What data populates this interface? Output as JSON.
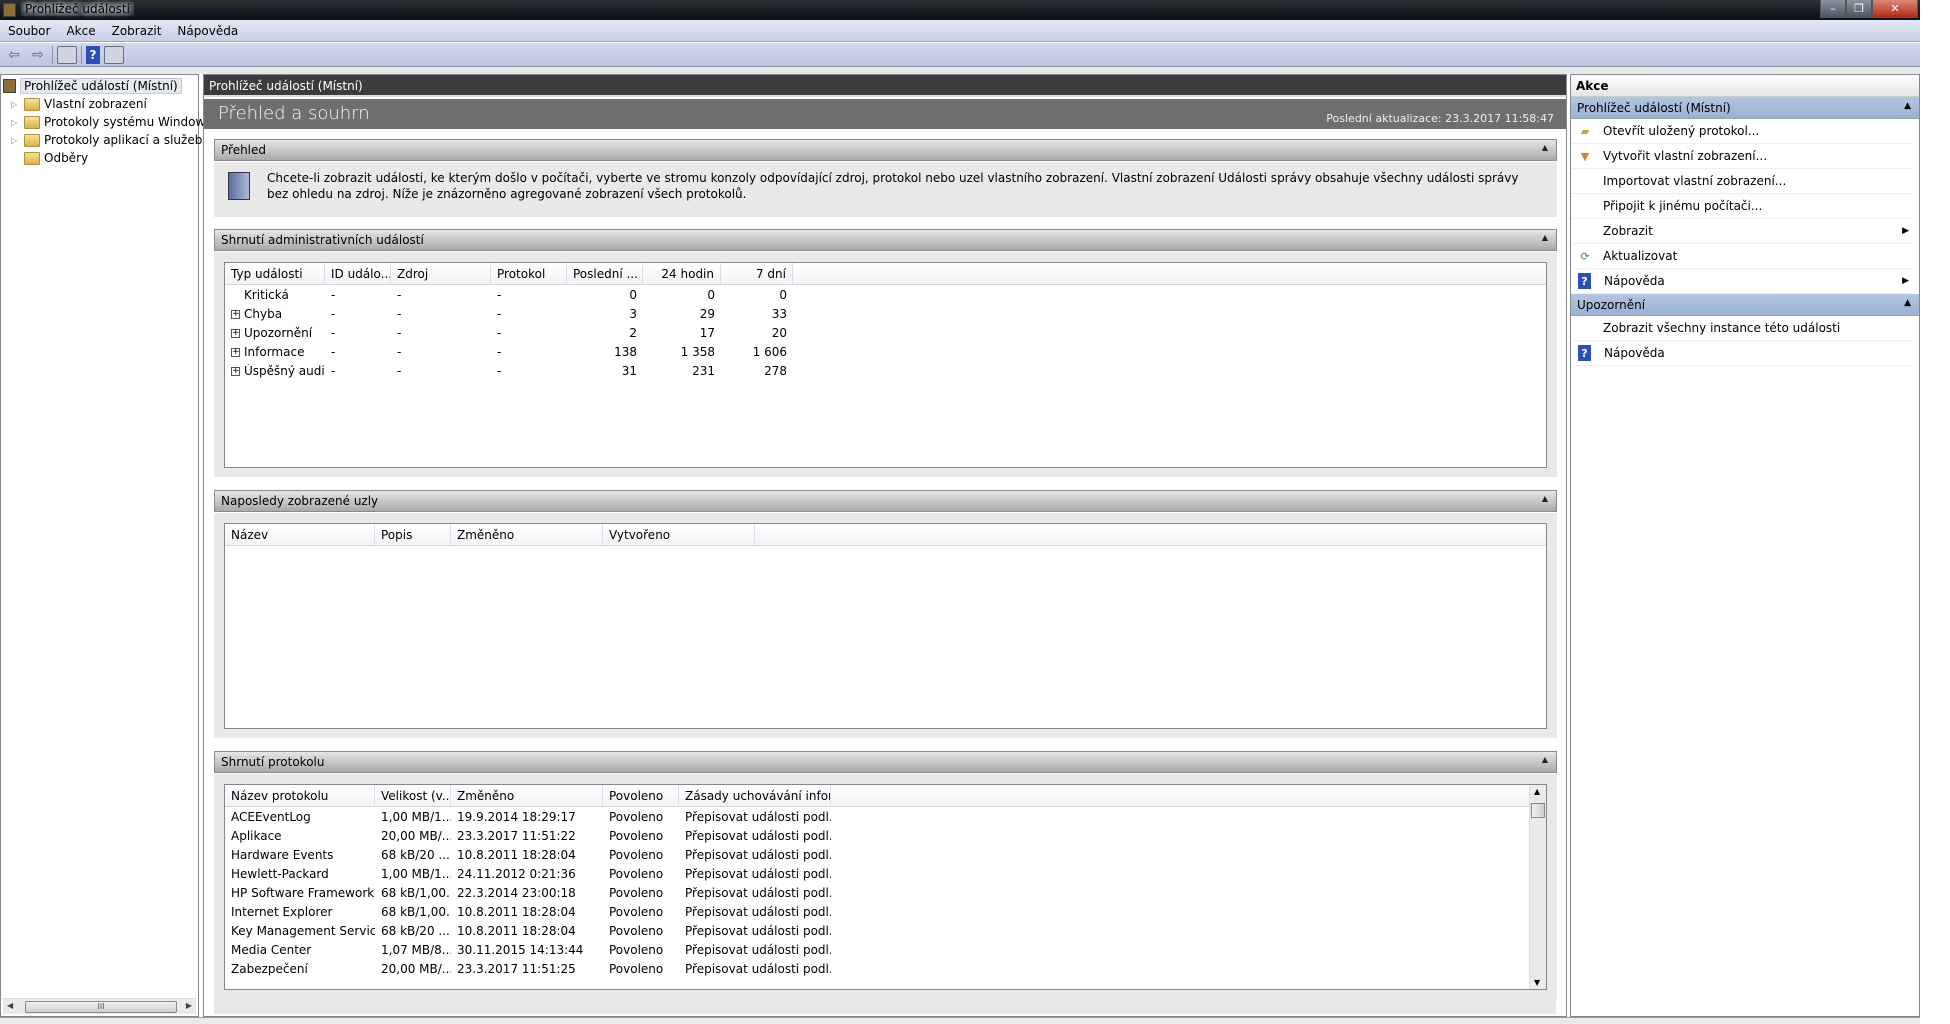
{
  "window": {
    "title": "Prohlížeč událostí",
    "minimize": "–",
    "restore": "❐",
    "close": "✕"
  },
  "menu": [
    "Soubor",
    "Akce",
    "Zobrazit",
    "Nápověda"
  ],
  "toolbar": {
    "back": "⇦",
    "forward": "⇨",
    "help": "?"
  },
  "tree": {
    "root": "Prohlížeč událostí (Místní)",
    "items": [
      "Vlastní zobrazení",
      "Protokoly systému Windows",
      "Protokoly aplikací a služeb",
      "Odběry"
    ]
  },
  "center": {
    "header": "Prohlížeč událostí (Místní)",
    "title": "Přehled a souhrn",
    "last_update": "Poslední aktualizace: 23.3.2017 11:58:47",
    "overview": {
      "title": "Přehled",
      "text": "Chcete-li zobrazit události, ke kterým došlo v počítači, vyberte ve stromu konzoly odpovídající zdroj, protokol nebo uzel vlastního zobrazení. Vlastní zobrazení Události správy obsahuje všechny události správy bez ohledu na zdroj. Níže je znázorněno agregované zobrazení všech protokolů."
    },
    "admin": {
      "title": "Shrnutí administrativních událostí",
      "columns": [
        "Typ události",
        "ID událo...",
        "Zdroj",
        "Protokol",
        "Poslední ...",
        "24 hodin",
        "7 dní"
      ],
      "rows": [
        {
          "type": "Kritická",
          "id": "-",
          "src": "-",
          "log": "-",
          "last": "0",
          "h24": "0",
          "d7": "0",
          "expand": ""
        },
        {
          "type": "Chyba",
          "id": "-",
          "src": "-",
          "log": "-",
          "last": "3",
          "h24": "29",
          "d7": "33",
          "expand": "+"
        },
        {
          "type": "Upozornění",
          "id": "-",
          "src": "-",
          "log": "-",
          "last": "2",
          "h24": "17",
          "d7": "20",
          "expand": "+"
        },
        {
          "type": "Informace",
          "id": "-",
          "src": "-",
          "log": "-",
          "last": "138",
          "h24": "1 358",
          "d7": "1 606",
          "expand": "+"
        },
        {
          "type": "Úspěšný audit",
          "id": "-",
          "src": "-",
          "log": "-",
          "last": "31",
          "h24": "231",
          "d7": "278",
          "expand": "+"
        }
      ]
    },
    "recent": {
      "title": "Naposledy zobrazené uzly",
      "columns": [
        "Název",
        "Popis",
        "Změněno",
        "Vytvořeno"
      ]
    },
    "logs": {
      "title": "Shrnutí protokolu",
      "columns": [
        "Název protokolu",
        "Velikost (v...",
        "Změněno",
        "Povoleno",
        "Zásady uchovávání infor..."
      ],
      "rows": [
        [
          "ACEEventLog",
          "1,00 MB/1...",
          "19.9.2014 18:29:17",
          "Povoleno",
          "Přepisovat události podl..."
        ],
        [
          "Aplikace",
          "20,00 MB/...",
          "23.3.2017 11:51:22",
          "Povoleno",
          "Přepisovat události podl..."
        ],
        [
          "Hardware Events",
          "68 kB/20 ...",
          "10.8.2011 18:28:04",
          "Povoleno",
          "Přepisovat události podl..."
        ],
        [
          "Hewlett-Packard",
          "1,00 MB/1...",
          "24.11.2012 0:21:36",
          "Povoleno",
          "Přepisovat události podl..."
        ],
        [
          "HP Software Framework",
          "68 kB/1,00...",
          "22.3.2014 23:00:18",
          "Povoleno",
          "Přepisovat události podl..."
        ],
        [
          "Internet Explorer",
          "68 kB/1,00...",
          "10.8.2011 18:28:04",
          "Povoleno",
          "Přepisovat události podl..."
        ],
        [
          "Key Management Service",
          "68 kB/20 ...",
          "10.8.2011 18:28:04",
          "Povoleno",
          "Přepisovat události podl..."
        ],
        [
          "Media Center",
          "1,07 MB/8...",
          "30.11.2015 14:13:44",
          "Povoleno",
          "Přepisovat události podl..."
        ],
        [
          "Zabezpečení",
          "20,00 MB/...",
          "23.3.2017 11:51:25",
          "Povoleno",
          "Přepisovat události podl..."
        ]
      ]
    }
  },
  "actions": {
    "title": "Akce",
    "sections": [
      {
        "title": "Prohlížeč událostí (Místní)",
        "items": [
          {
            "label": "Otevřít uložený protokol...",
            "icon": "open-folder-icon",
            "sub": false
          },
          {
            "label": "Vytvořit vlastní zobrazení...",
            "icon": "filter-icon",
            "sub": false
          },
          {
            "label": "Importovat vlastní zobrazení...",
            "icon": "",
            "sub": false
          },
          {
            "label": "Připojit k jinému počítači...",
            "icon": "",
            "sub": false
          },
          {
            "label": "Zobrazit",
            "icon": "",
            "sub": true
          },
          {
            "label": "Aktualizovat",
            "icon": "refresh-icon",
            "sub": false
          },
          {
            "label": "Nápověda",
            "icon": "help-icon",
            "sub": true
          }
        ]
      },
      {
        "title": "Upozornění",
        "items": [
          {
            "label": "Zobrazit všechny instance této události",
            "icon": "",
            "sub": false
          },
          {
            "label": "Nápověda",
            "icon": "help-icon",
            "sub": false
          }
        ]
      }
    ]
  }
}
